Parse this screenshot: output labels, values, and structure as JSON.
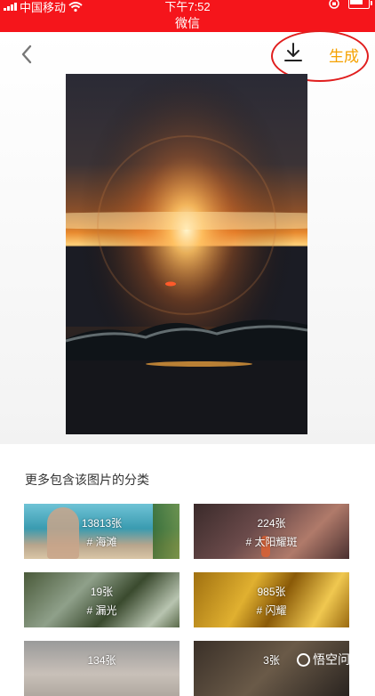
{
  "status_bar": {
    "carrier": "中国移动",
    "time": "下午7:52",
    "app_name": "微信"
  },
  "toolbar": {
    "back_icon": "chevron-left-icon",
    "download_icon": "download-icon",
    "generate_label": "生成",
    "accent_color": "#f5a100",
    "annotation_color": "#e01e1e"
  },
  "section": {
    "title": "更多包含该图片的分类"
  },
  "categories": [
    {
      "count": "13813张",
      "tag": "# 海滩"
    },
    {
      "count": "224张",
      "tag": "# 太阳耀斑"
    },
    {
      "count": "19张",
      "tag": "# 漏光"
    },
    {
      "count": "985张",
      "tag": "# 闪耀"
    },
    {
      "count": "134张",
      "tag": ""
    },
    {
      "count": "3张",
      "tag": ""
    }
  ],
  "watermark": {
    "text": "悟空问答"
  },
  "colors": {
    "status_bar": "#f5151b"
  }
}
